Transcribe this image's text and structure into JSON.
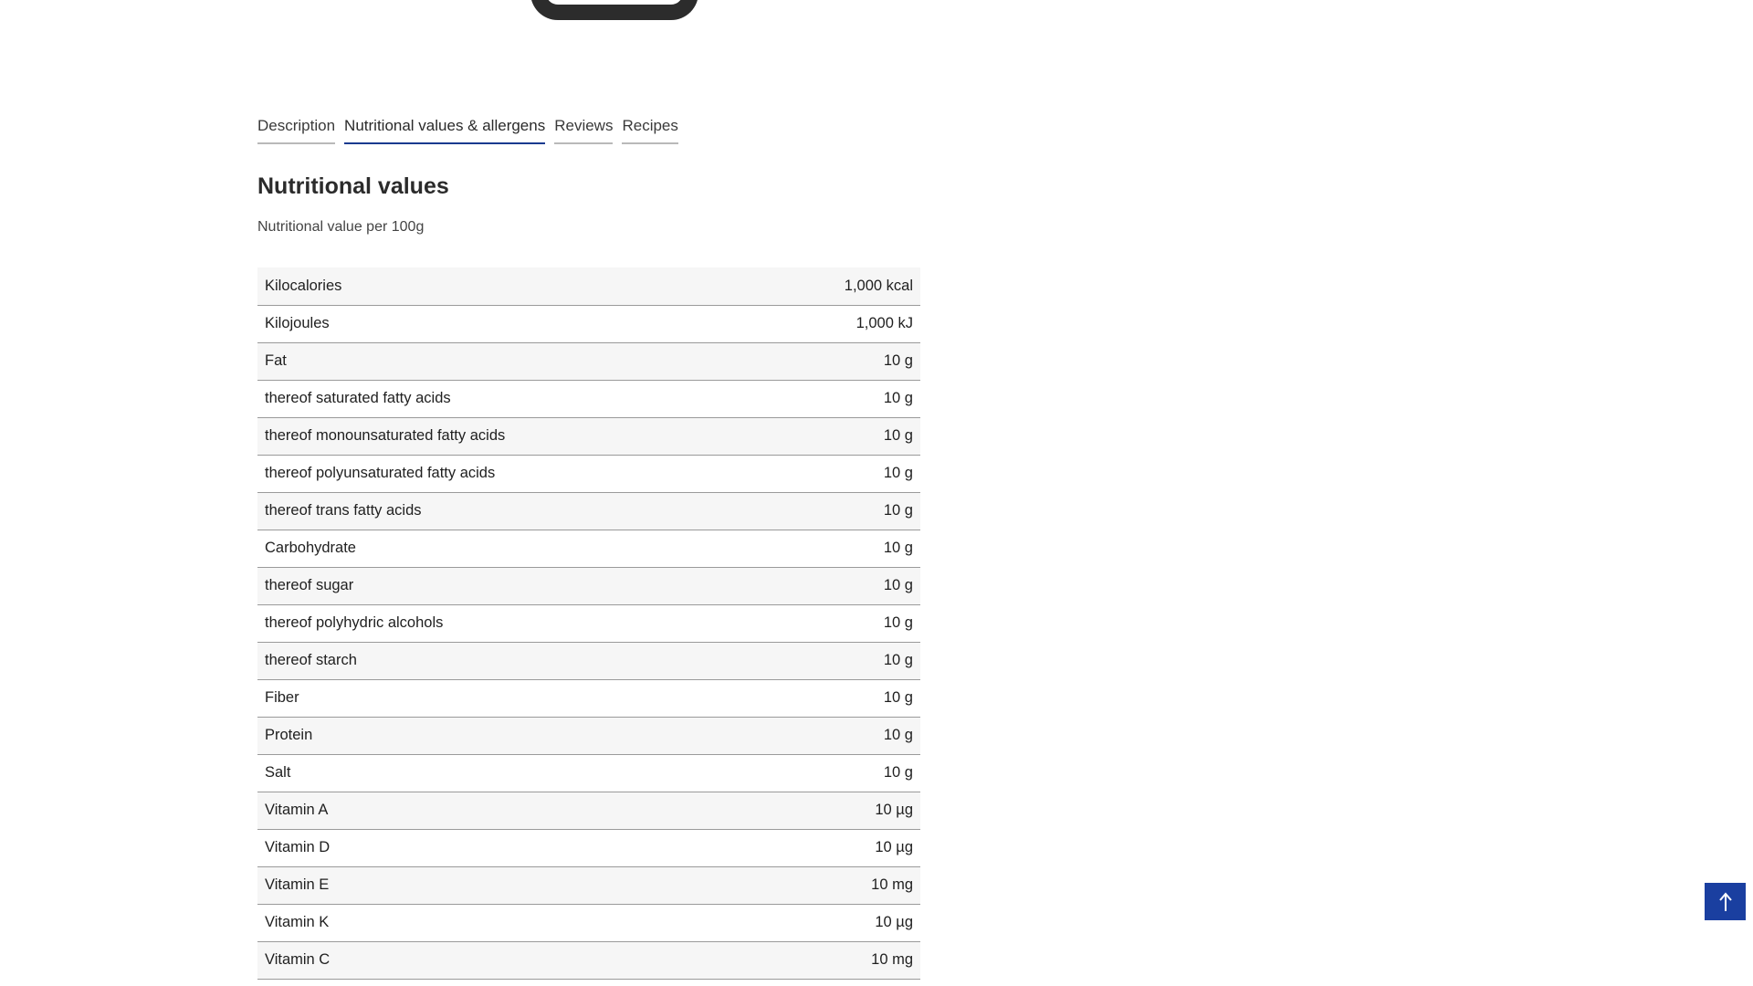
{
  "tabs": [
    {
      "label": "Description",
      "active": false
    },
    {
      "label": "Nutritional values & allergens",
      "active": true
    },
    {
      "label": "Reviews",
      "active": false
    },
    {
      "label": "Recipes",
      "active": false
    }
  ],
  "section": {
    "title": "Nutritional values",
    "subtitle": "Nutritional value per 100g"
  },
  "nutrition": {
    "rows": [
      {
        "name": "Kilocalories",
        "value": "1,000 kcal"
      },
      {
        "name": "Kilojoules",
        "value": "1,000 kJ"
      },
      {
        "name": "Fat",
        "value": "10 g"
      },
      {
        "name": "thereof saturated fatty acids",
        "value": "10 g"
      },
      {
        "name": "thereof monounsaturated fatty acids",
        "value": "10 g"
      },
      {
        "name": "thereof polyunsaturated fatty acids",
        "value": "10 g"
      },
      {
        "name": "thereof trans fatty acids",
        "value": "10 g"
      },
      {
        "name": "Carbohydrate",
        "value": "10 g"
      },
      {
        "name": "thereof sugar",
        "value": "10 g"
      },
      {
        "name": "thereof polyhydric alcohols",
        "value": "10 g"
      },
      {
        "name": "thereof starch",
        "value": "10 g"
      },
      {
        "name": "Fiber",
        "value": "10 g"
      },
      {
        "name": "Protein",
        "value": "10 g"
      },
      {
        "name": "Salt",
        "value": "10 g"
      },
      {
        "name": "Vitamin A",
        "value": "10 µg"
      },
      {
        "name": "Vitamin D",
        "value": "10 µg"
      },
      {
        "name": "Vitamin E",
        "value": "10 mg"
      },
      {
        "name": "Vitamin K",
        "value": "10 µg"
      },
      {
        "name": "Vitamin C",
        "value": "10 mg"
      }
    ]
  },
  "icons": {
    "scroll_top": "arrow-up-icon"
  },
  "colors": {
    "accent": "#1a3fa0",
    "active_tab_underline": "#1a3a8f"
  }
}
